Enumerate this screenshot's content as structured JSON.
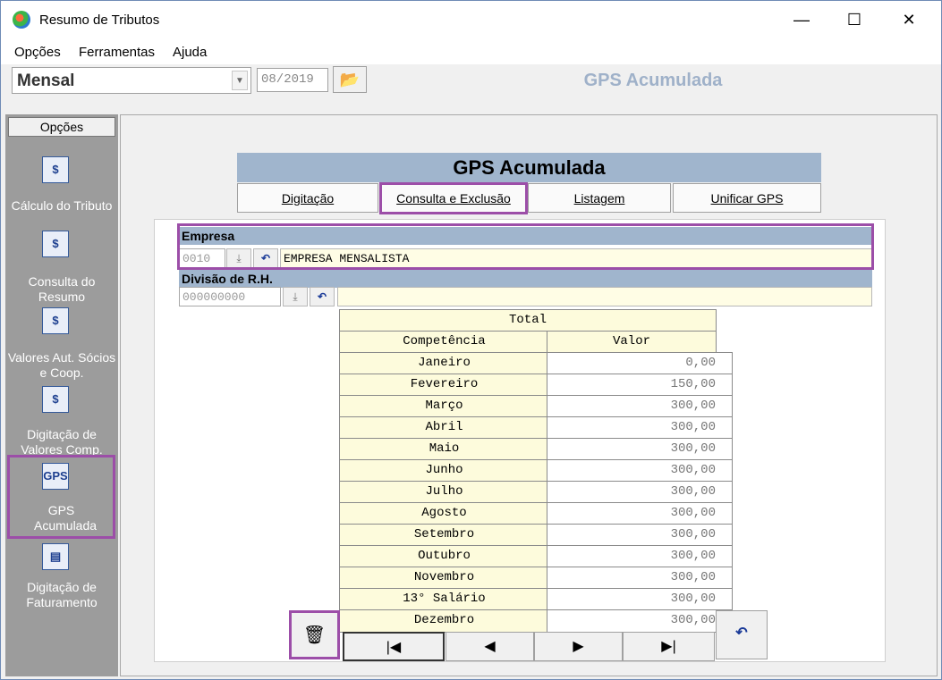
{
  "window": {
    "title": "Resumo de Tributos",
    "controls": [
      "—",
      "☐",
      "✕"
    ]
  },
  "menu": [
    "Opções",
    "Ferramentas",
    "Ajuda"
  ],
  "toolbar": {
    "period": "Mensal",
    "date": "08/2019",
    "screen_title": "GPS Acumulada"
  },
  "sidebar": {
    "header": "Opções",
    "items": [
      {
        "label": "Cálculo do Tributo",
        "icon": "calculator-icon",
        "glyph": "$"
      },
      {
        "label": "Consulta do Resumo",
        "icon": "computer-icon",
        "glyph": "$"
      },
      {
        "label": "Valores Aut. Sócios e Coop.",
        "icon": "people-icon",
        "glyph": "$"
      },
      {
        "label": "Digitação de Valores Comp.",
        "icon": "document-icon",
        "glyph": "$"
      },
      {
        "label": "GPS Acumulada",
        "icon": "gps-icon",
        "glyph": "GPS"
      },
      {
        "label": "Digitação de Faturamento",
        "icon": "book-icon",
        "glyph": "▤"
      }
    ]
  },
  "panel": {
    "title": "GPS Acumulada",
    "tabs": [
      "Digitação",
      "Consulta e Exclusão",
      "Listagem",
      "Unificar GPS"
    ]
  },
  "empresa": {
    "label": "Empresa",
    "code": "0010",
    "name": "EMPRESA MENSALISTA"
  },
  "divisao": {
    "label": "Divisão de R.H.",
    "code": "000000000",
    "name": ""
  },
  "table": {
    "caption": "Total",
    "headers": [
      "Competência",
      "Valor"
    ],
    "rows": [
      [
        "Janeiro",
        "0,00"
      ],
      [
        "Fevereiro",
        "150,00"
      ],
      [
        "Março",
        "300,00"
      ],
      [
        "Abril",
        "300,00"
      ],
      [
        "Maio",
        "300,00"
      ],
      [
        "Junho",
        "300,00"
      ],
      [
        "Julho",
        "300,00"
      ],
      [
        "Agosto",
        "300,00"
      ],
      [
        "Setembro",
        "300,00"
      ],
      [
        "Outubro",
        "300,00"
      ],
      [
        "Novembro",
        "300,00"
      ],
      [
        "13° Salário",
        "300,00"
      ],
      [
        "Dezembro",
        "300,00"
      ]
    ]
  },
  "nav": {
    "first": "|◀",
    "prev": "◀",
    "next": "▶",
    "last": "▶|"
  }
}
